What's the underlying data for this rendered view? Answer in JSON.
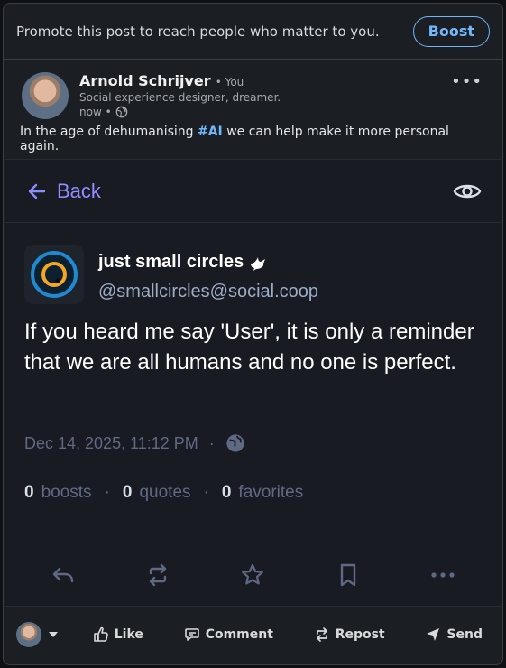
{
  "promote": {
    "text": "Promote this post to reach people who matter to you.",
    "boost_label": "Boost"
  },
  "author": {
    "name": "Arnold Schrijver",
    "you_label": "• You",
    "headline": "Social experience designer, dreamer.",
    "time": "now •"
  },
  "post": {
    "text_before": "In the age of dehumanising ",
    "hashtag": "#AI",
    "text_after": " we can help make it more personal again."
  },
  "embed": {
    "back_label": "Back",
    "display_name": "just small circles",
    "handle": "@smallcircles@social.coop",
    "content": "If you heard me say 'User', it is only a reminder that we are all humans and no one is perfect.",
    "timestamp": "Dec 14, 2025, 11:12 PM",
    "dot": "·",
    "boosts_count": "0",
    "boosts_label": "boosts",
    "quotes_count": "0",
    "quotes_label": "quotes",
    "favorites_count": "0",
    "favorites_label": "favorites",
    "accent": "#8c8dff"
  },
  "bottom_bar": {
    "like": "Like",
    "comment": "Comment",
    "repost": "Repost",
    "send": "Send"
  }
}
